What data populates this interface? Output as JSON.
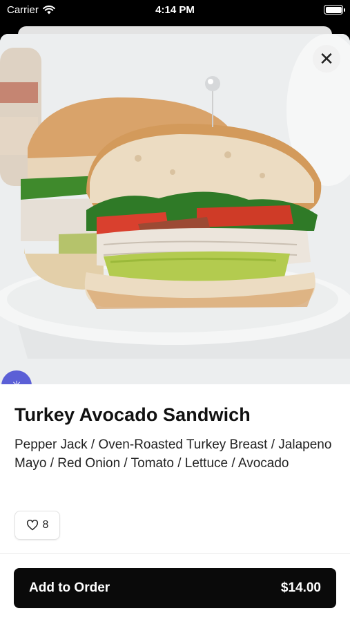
{
  "status_bar": {
    "carrier": "Carrier",
    "time": "4:14 PM",
    "battery_level": 1.0
  },
  "item": {
    "image_alt": "Turkey Avocado Sandwich photo",
    "title": "Turkey Avocado Sandwich",
    "description": "Pepper Jack / Oven-Roasted Turkey Breast / Jalapeno Mayo / Red Onion / Tomato / Lettuce / Avocado",
    "likes": "8"
  },
  "actions": {
    "close_icon": "close-icon",
    "order_label": "Add to Order",
    "order_price": "$14.00"
  },
  "colors": {
    "primary": "#0a0a0a",
    "badge": "#5b5fd6"
  }
}
